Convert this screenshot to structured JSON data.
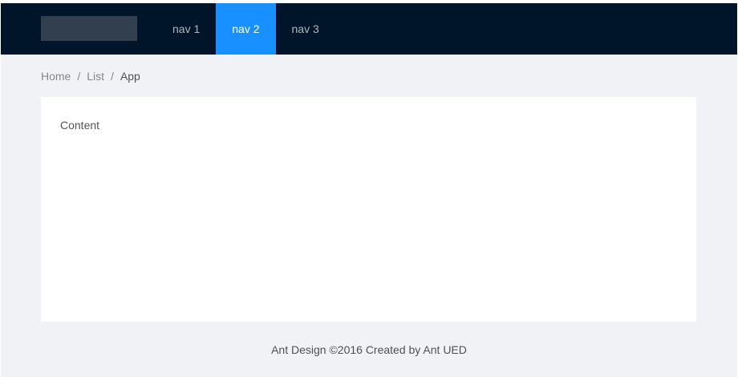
{
  "header": {
    "nav": [
      {
        "label": "nav 1",
        "selected": false
      },
      {
        "label": "nav 2",
        "selected": true
      },
      {
        "label": "nav 3",
        "selected": false
      }
    ]
  },
  "breadcrumb": {
    "items": [
      "Home",
      "List",
      "App"
    ],
    "separator": "/"
  },
  "content": {
    "text": "Content"
  },
  "footer": {
    "text": "Ant Design ©2016 Created by Ant UED"
  },
  "colors": {
    "header_bg": "#001529",
    "accent": "#1890ff",
    "page_bg": "#f0f2f5",
    "logo_placeholder": "#323f4f"
  }
}
